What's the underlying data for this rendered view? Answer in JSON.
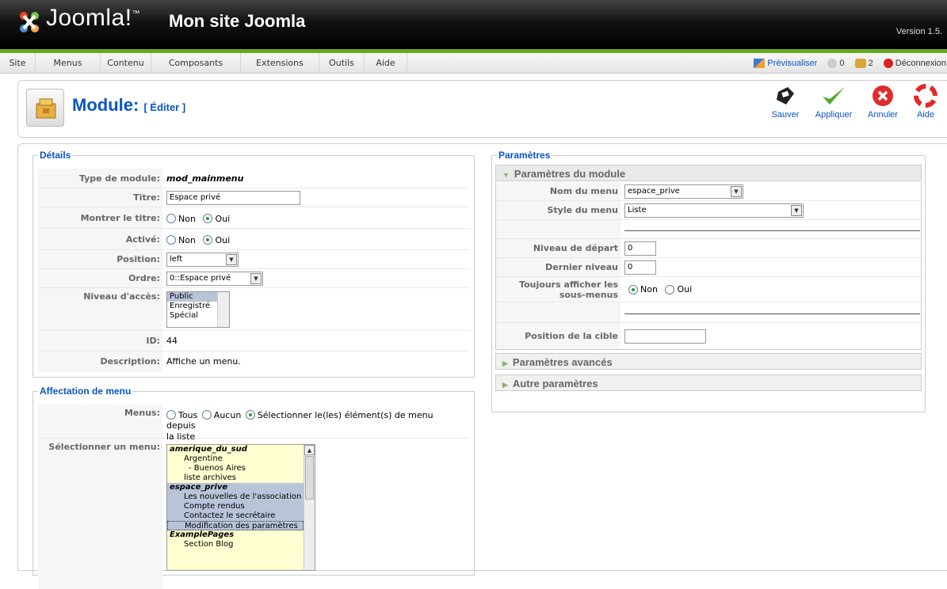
{
  "header": {
    "brand": "Joomla!",
    "brand_tm": "™",
    "site_name": "Mon site Joomla",
    "version": "Version 1.5."
  },
  "menubar": {
    "items": [
      "Site",
      "Menus",
      "Contenu",
      "Composants",
      "Extensions",
      "Outils",
      "Aide"
    ],
    "preview": "Prévisualiser",
    "messages_count": "0",
    "users_count": "2",
    "logout": "Déconnexion"
  },
  "toolbar": {
    "title": "Module:",
    "subtitle": "[ Éditer ]",
    "buttons": {
      "save": "Sauver",
      "apply": "Appliquer",
      "cancel": "Annuler",
      "help": "Aide"
    }
  },
  "details": {
    "legend": "Détails",
    "module_type_label": "Type de module:",
    "module_type": "mod_mainmenu",
    "title_label": "Titre:",
    "title_value": "Espace privé",
    "show_title_label": "Montrer le titre:",
    "no": "Non",
    "yes": "Oui",
    "enabled_label": "Activé:",
    "position_label": "Position:",
    "position_value": "left",
    "order_label": "Ordre:",
    "order_value": "0::Espace privé",
    "access_label": "Niveau d'accès:",
    "access_options": [
      "Public",
      "Enregistré",
      "Spécial"
    ],
    "id_label": "ID:",
    "id_value": "44",
    "description_label": "Description:",
    "description_value": "Affiche un menu."
  },
  "menu_assignment": {
    "legend": "Affectation de menu",
    "menus_label": "Menus:",
    "all": "Tous",
    "none": "Aucun",
    "select_line1": "Sélectionner le(les) élément(s) de menu depuis",
    "select_line2": "la liste",
    "select_menu_label": "Sélectionner un menu:",
    "items": [
      {
        "text": "amerique_du_sud",
        "type": "group"
      },
      {
        "text": "Argentine",
        "type": "item"
      },
      {
        "text": "- Buenos Aires",
        "type": "sub"
      },
      {
        "text": "liste archives",
        "type": "item"
      },
      {
        "text": "espace_prive",
        "type": "group"
      },
      {
        "text": "Les nouvelles de l'association",
        "type": "sel"
      },
      {
        "text": "Compte rendus",
        "type": "sel"
      },
      {
        "text": "Contactez le secrétaire",
        "type": "sel"
      },
      {
        "text": "Modification des paramètres",
        "type": "sel"
      },
      {
        "text": "ExamplePages",
        "type": "group"
      },
      {
        "text": "Section Blog",
        "type": "item"
      }
    ]
  },
  "params": {
    "legend": "Paramètres",
    "module_params": "Paramètres du module",
    "menu_name_label": "Nom du menu",
    "menu_name_value": "espace_prive",
    "menu_style_label": "Style du menu",
    "menu_style_value": "Liste",
    "start_level_label": "Niveau de départ",
    "start_level_value": "0",
    "end_level_label": "Dernier niveau",
    "end_level_value": "0",
    "always_show_label": "Toujours afficher les sous-menus",
    "target_position_label": "Position de la cible",
    "target_position_value": "",
    "advanced": "Paramètres avancés",
    "other": "Autre paramètres"
  },
  "colors": {
    "accent": "#0b55c4",
    "green": "#65a81e",
    "selection": "#b8c4d8",
    "menu_bg": "#fefed0"
  }
}
